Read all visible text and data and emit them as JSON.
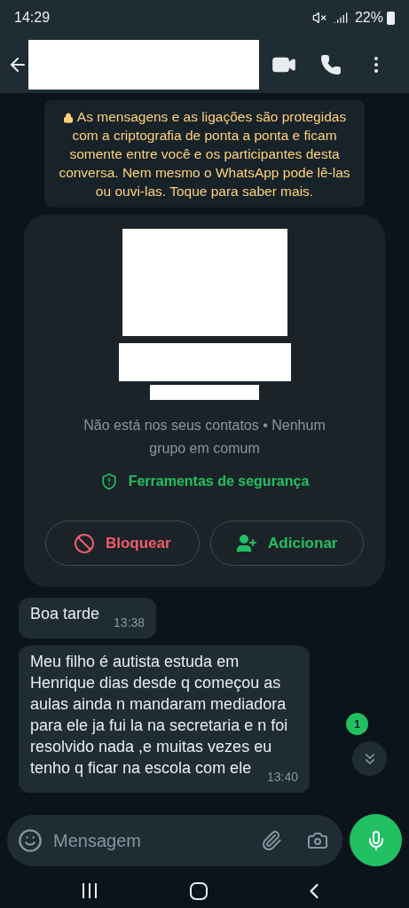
{
  "status_bar": {
    "time": "14:29",
    "battery": "22%"
  },
  "encryption_notice": "As mensagens e as ligações são protegidas com a criptografia de ponta a ponta e ficam somente entre você e os participantes desta conversa. Nem mesmo o WhatsApp pode lê-las ou ouvi-las. Toque para saber mais.",
  "contact_card": {
    "info": "Não está nos seus contatos • Nenhum grupo em comum",
    "safety_link": "Ferramentas de segurança",
    "buttons": [
      {
        "kind": "block",
        "label": "Bloquear"
      },
      {
        "kind": "add",
        "label": "Adicionar"
      }
    ]
  },
  "messages": [
    {
      "text": "Boa tarde",
      "time": "13:38"
    },
    {
      "text": "Meu filho é autista estuda em Henrique dias desde q começou as aulas ainda n mandaram mediadora para ele ja fui la na secretaria e n foi resolvido nada ,e muitas vezes eu tenho q ficar na escola com ele",
      "time": "13:40"
    }
  ],
  "unread_badge": "1",
  "composer": {
    "placeholder": "Mensagem"
  }
}
